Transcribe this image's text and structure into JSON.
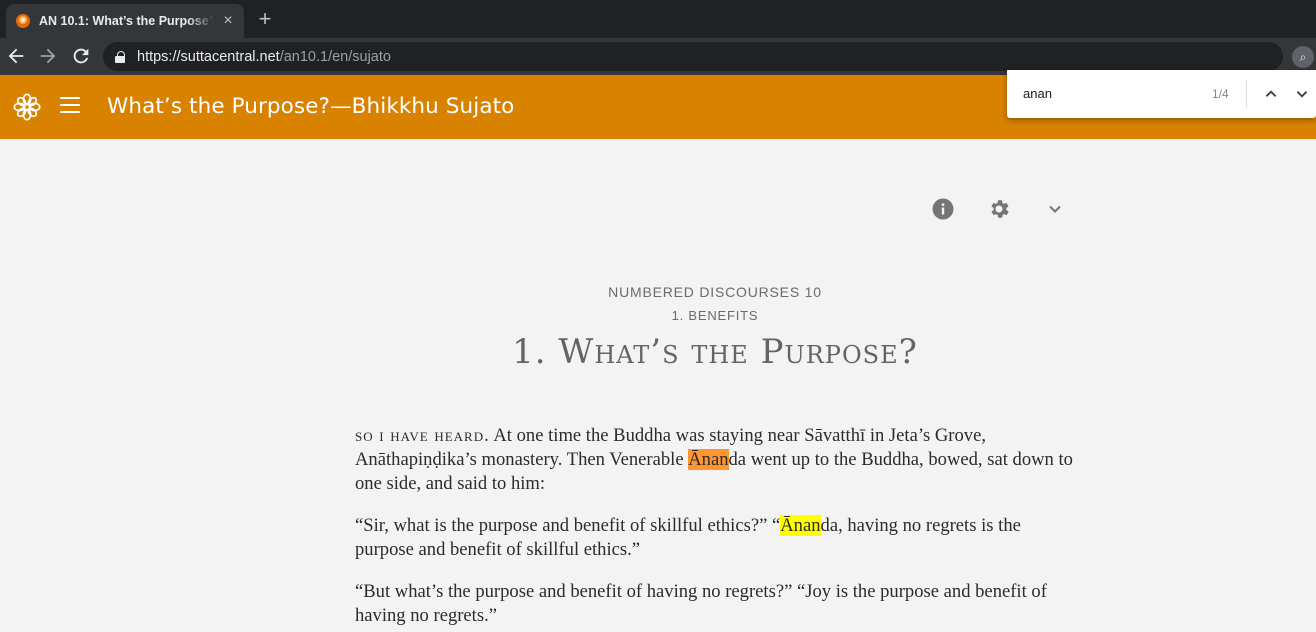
{
  "browser": {
    "tab_title": "AN 10.1: What’s the Purpose?—Bhikkhu Sujato",
    "tab_close": "×",
    "new_tab": "+",
    "url_scheme": "https://",
    "url_host": "suttacentral.net",
    "url_path": "/an10.1/en/sujato"
  },
  "header": {
    "title": "What’s the Purpose?—Bhikkhu Sujato"
  },
  "find": {
    "query": "anan",
    "count": "1/4"
  },
  "text": {
    "division": "Numbered Discourses 10",
    "subdivision": "1. Benefits",
    "title": "1. What’s the Purpose?",
    "p1": {
      "evam": "So I have heard.",
      "before": " At one time the Buddha was staying near Sāvatthī in Jeta’s Grove, Anāthapiṇḍika’s monastery. Then Venerable ",
      "match": "Ānan",
      "after": "da went up to the Buddha, bowed, sat down to one side, and said to him:"
    },
    "p2": {
      "before": "“Sir, what is the purpose and benefit of skillful ethics?” “",
      "match": "Ānan",
      "after": "da, having no regrets is the purpose and benefit of skillful ethics.”"
    },
    "p3": "“But what’s the purpose and benefit of having no regrets?” “Joy is the purpose and benefit of having no regrets.”"
  },
  "colors": {
    "header": "#d98200",
    "active_match": "#ff9632",
    "match": "#ffff00"
  },
  "icons": [
    "info-icon",
    "gear-icon",
    "chevron-down-icon",
    "menu-icon",
    "suttacentral-logo-icon"
  ]
}
